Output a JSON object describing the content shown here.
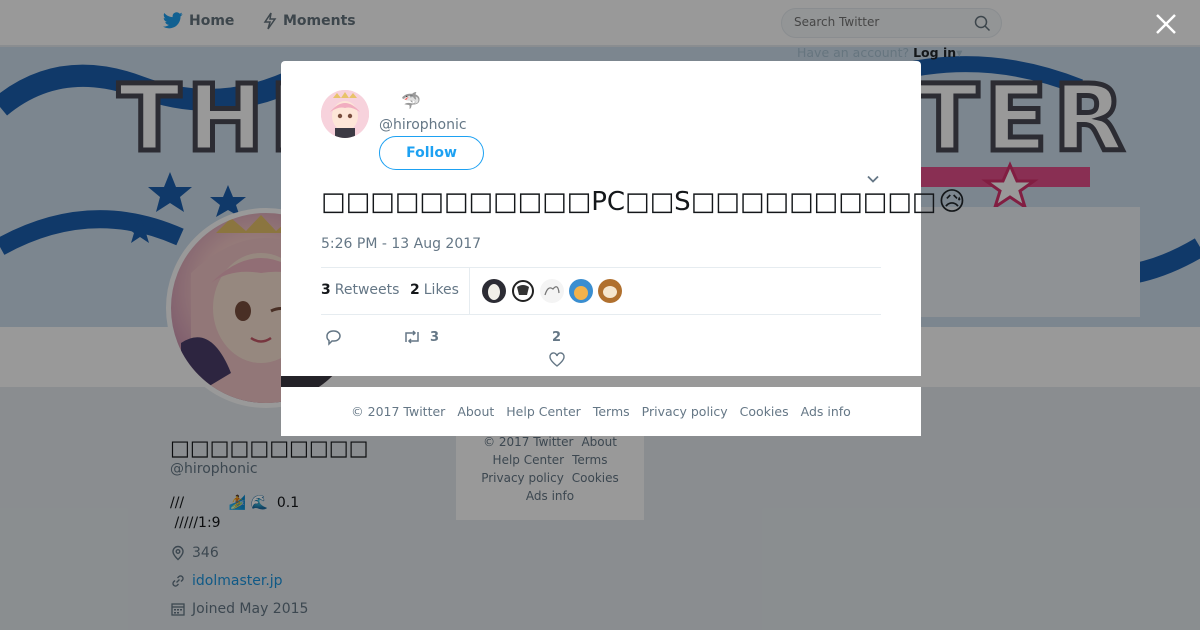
{
  "nav": {
    "home_label": "Home",
    "moments_label": "Moments",
    "search_placeholder": "Search Twitter",
    "have_account": "Have an account?",
    "login_label": "Log in"
  },
  "banner": {
    "text": "THE IDOLM@STER"
  },
  "profile": {
    "name": "□□□□□□□□□□",
    "handle": "@hirophonic",
    "bio_line1": "///          🏄 🌊  0.1",
    "bio_line2": " /////1:9",
    "location": "346",
    "url": "idolmaster.jp",
    "joined": "Joined May 2015"
  },
  "side_footer": {
    "copyright": "© 2017 Twitter",
    "about": "About",
    "help": "Help Center",
    "terms": "Terms",
    "privacy": "Privacy policy",
    "cookies": "Cookies",
    "ads": "Ads info"
  },
  "tweet": {
    "author_name_emoji": "🦈",
    "author_handle": "@hirophonic",
    "follow_label": "Follow",
    "text": "□□□□□□□□□□□PC□□S□□□□□□□□□□",
    "text_emoji": "😥",
    "timestamp": "5:26 PM - 13 Aug 2017",
    "retweets_count": "3",
    "retweets_label": "Retweets",
    "likes_count": "2",
    "likes_label": "Likes",
    "action_retweet_count": "3",
    "action_like_count": "2"
  },
  "modal_footer": {
    "copyright": "© 2017 Twitter",
    "about": "About",
    "help": "Help Center",
    "terms": "Terms",
    "privacy": "Privacy policy",
    "cookies": "Cookies",
    "ads": "Ads info"
  },
  "colors": {
    "twitter_blue": "#1da1f2",
    "link_blue": "#1b95e0",
    "muted": "#657786",
    "overlay": "rgba(0,0,0,0.40)"
  }
}
